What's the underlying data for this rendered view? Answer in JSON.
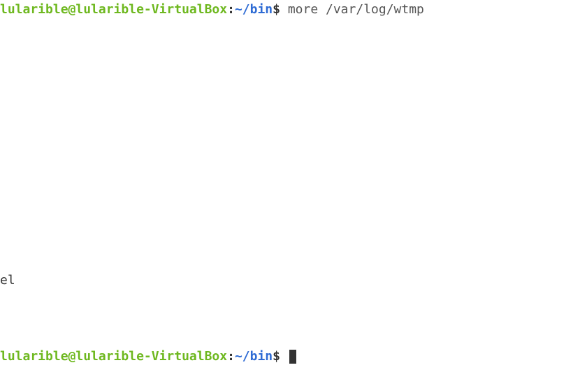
{
  "prompt1": {
    "user_host": "lularible@lularible-VirtualBox",
    "colon": ":",
    "path": "~/bin",
    "dollar": "$ ",
    "command": "more /var/log/wtmp"
  },
  "output": {
    "text": "el"
  },
  "prompt2": {
    "user_host": "lularible@lularible-VirtualBox",
    "colon": ":",
    "path": "~/bin",
    "dollar": "$ "
  }
}
